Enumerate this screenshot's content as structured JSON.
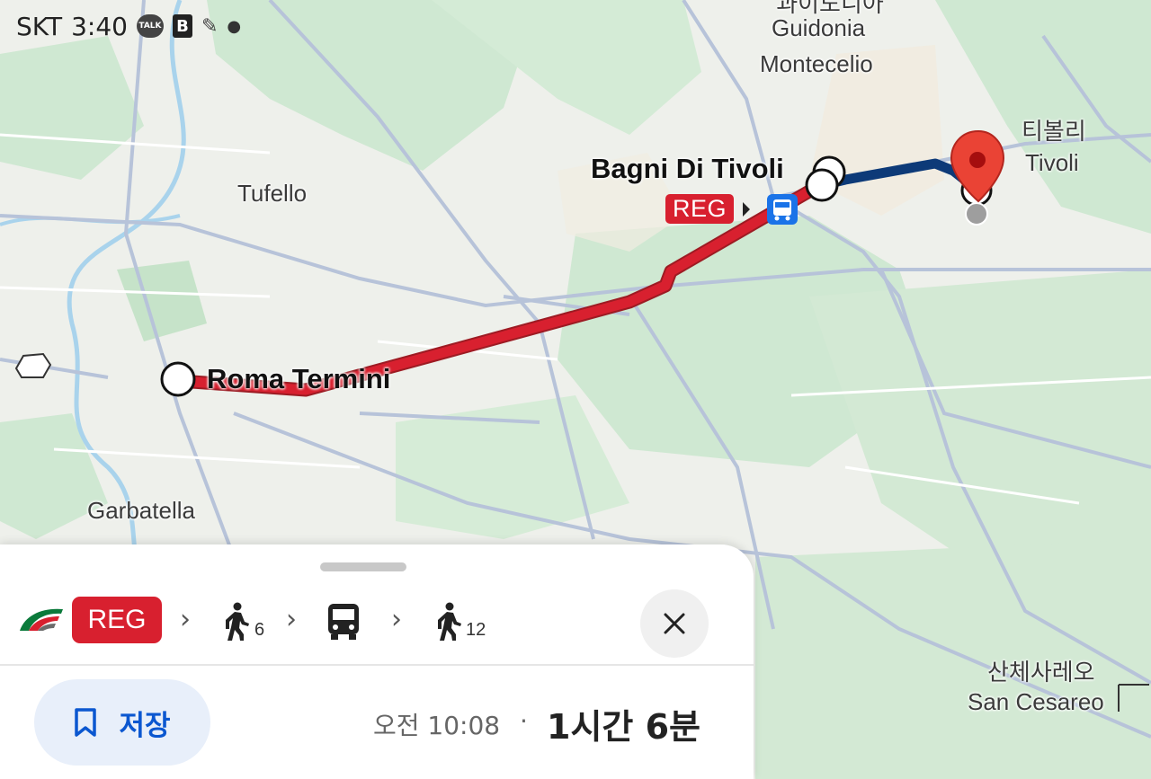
{
  "status_bar": {
    "carrier": "SKT",
    "time": "3:40",
    "talk_badge": "TALK",
    "b_badge": "B"
  },
  "map": {
    "labels": {
      "guidonia_ko": "과이도니아",
      "guidonia": "Guidonia",
      "montecelio": "Montecelio",
      "tivoli_ko": "티볼리",
      "tivoli": "Tivoli",
      "tufello": "Tufello",
      "bagni": "Bagni Di Tivoli",
      "roma_termini": "Roma Termini",
      "garbatella": "Garbatella",
      "san_cesareo_ko": "산체사레오",
      "san_cesareo": "San Cesareo"
    },
    "reg_tag": "REG",
    "colors": {
      "rail": "#d8202f",
      "walk": "#0d3a78",
      "pin": "#ea4335"
    }
  },
  "sheet": {
    "route": {
      "operator_icon": "trenitalia-icon",
      "train_label": "REG",
      "walk1_minutes": "6",
      "bus_icon": "bus-icon",
      "walk2_minutes": "12"
    },
    "save_label": "저장",
    "departure": "오전 10:08",
    "separator": "·",
    "duration": "1시간 6분"
  }
}
